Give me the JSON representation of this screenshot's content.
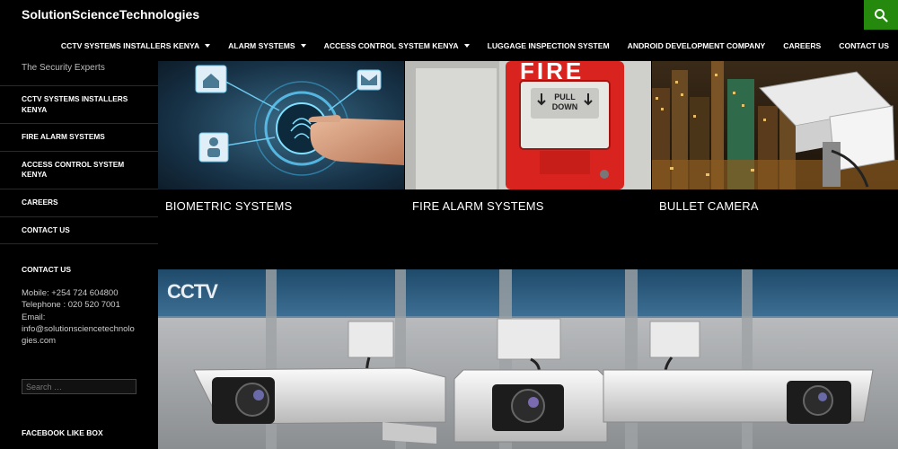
{
  "header": {
    "site_title": "SolutionScienceTechnologies",
    "accent_color": "#24890d",
    "search_icon": "search-icon"
  },
  "primary_nav": [
    {
      "label": "CCTV SYSTEMS INSTALLERS KENYA",
      "has_dropdown": true
    },
    {
      "label": "ALARM SYSTEMS",
      "has_dropdown": true
    },
    {
      "label": "ACCESS CONTROL SYSTEM KENYA",
      "has_dropdown": true
    },
    {
      "label": "LUGGAGE INSPECTION SYSTEM",
      "has_dropdown": false
    },
    {
      "label": "ANDROID DEVELOPMENT COMPANY",
      "has_dropdown": false
    },
    {
      "label": "CAREERS",
      "has_dropdown": false
    },
    {
      "label": "CONTACT US",
      "has_dropdown": false
    }
  ],
  "sidebar": {
    "description": "The Security Experts",
    "menu": [
      {
        "label": "CCTV SYSTEMS INSTALLERS KENYA"
      },
      {
        "label": "FIRE ALARM SYSTEMS"
      },
      {
        "label": "ACCESS CONTROL SYSTEM KENYA"
      },
      {
        "label": "CAREERS"
      },
      {
        "label": "CONTACT US"
      }
    ],
    "contact": {
      "title": "CONTACT US",
      "mobile": "Mobile: +254 724 604800",
      "telephone": "Telephone : 020 520 7001",
      "email_label": "Email:",
      "email": "info@solutionsciencetechnologies.com"
    },
    "search": {
      "placeholder": "Search …"
    },
    "facebook_title": "FACEBOOK LIKE BOX"
  },
  "featured": [
    {
      "title": "BIOMETRIC SYSTEMS"
    },
    {
      "title": "FIRE ALARM SYSTEMS",
      "sign_text": "FIRE",
      "pull_text_1": "PULL",
      "pull_text_2": "DOWN"
    },
    {
      "title": "BULLET CAMERA"
    }
  ],
  "banner": {
    "label": "CCTV"
  }
}
